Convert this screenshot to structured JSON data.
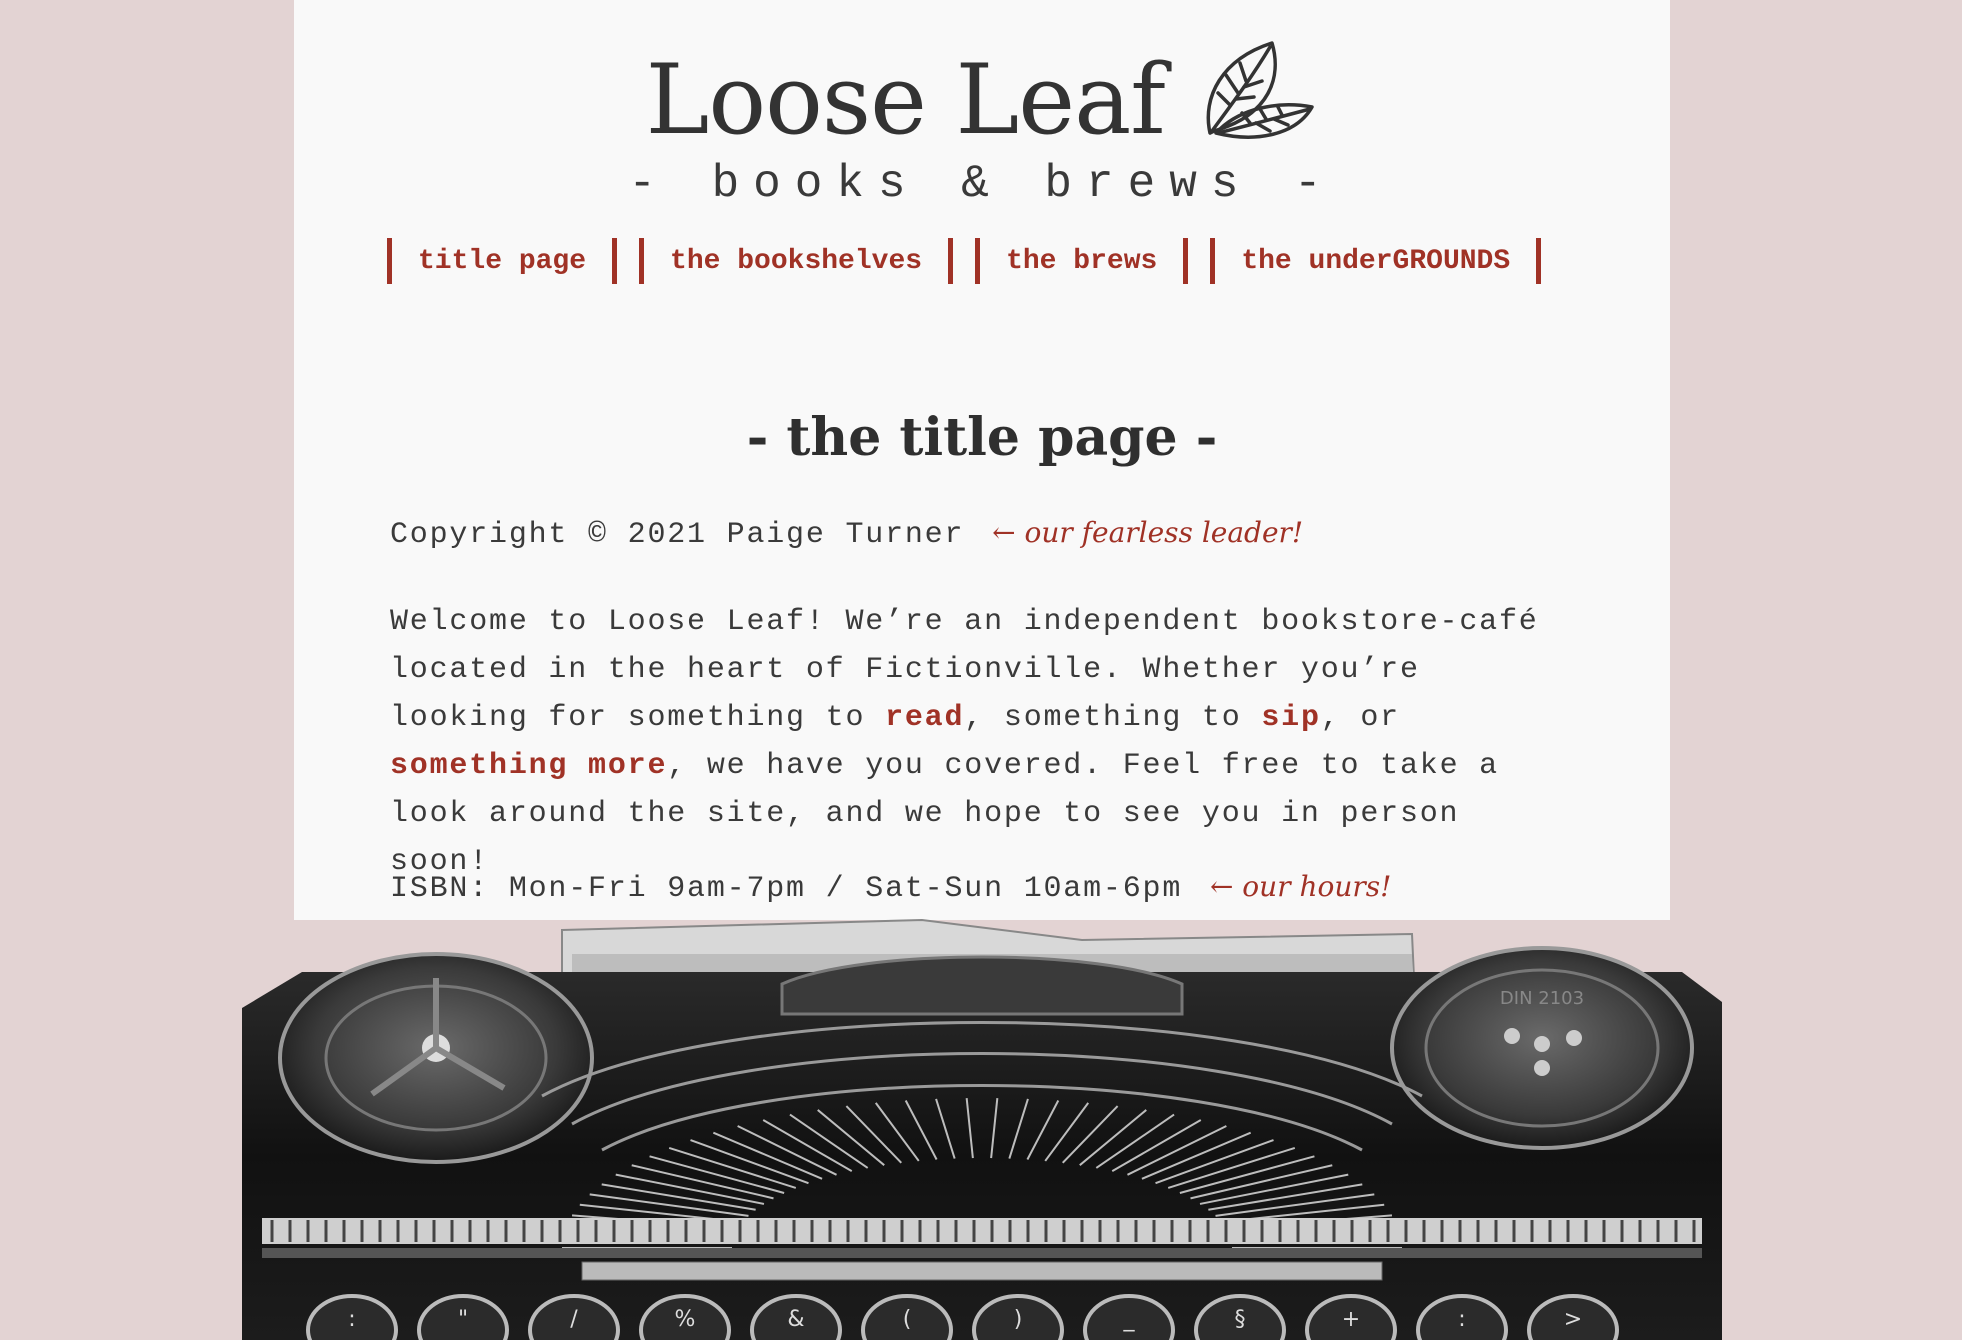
{
  "brand": {
    "title": "Loose Leaf",
    "tagline": "- books & brews -",
    "logo_icon": "leaf-icon"
  },
  "nav": {
    "items": [
      {
        "label": "title page"
      },
      {
        "label": "the bookshelves"
      },
      {
        "label": "the brews"
      },
      {
        "label": "the underGROUNDS"
      }
    ]
  },
  "main": {
    "section_title": "- the title page -",
    "copyright": "Copyright © 2021 Paige Turner",
    "copyright_note": "← our fearless leader!",
    "welcome": {
      "part1": "Welcome to Loose Leaf! We’re an independent bookstore-café located in the heart of Fictionville. Whether you’re looking for something to ",
      "link_read": "read",
      "part2": ", something to ",
      "link_sip": "sip",
      "part3": ", or ",
      "link_more": "something more",
      "part4": ", we have you covered. Feel free to take a look around the site, and we hope to see you in person soon!"
    },
    "hours": "ISBN: Mon-Fri 9am-7pm / Sat-Sun 10am-6pm",
    "hours_note": "← our hours!"
  },
  "colors": {
    "background": "#e3d3d3",
    "page": "#f9f9f9",
    "accent": "#a03226",
    "text": "#3a3a3a"
  },
  "typewriter": {
    "spool_label": "DIN 2103",
    "keys": [
      ":",
      "\"",
      "/",
      "%",
      "&",
      "(",
      ")",
      "_",
      "§",
      "+",
      ":",
      ">"
    ]
  }
}
